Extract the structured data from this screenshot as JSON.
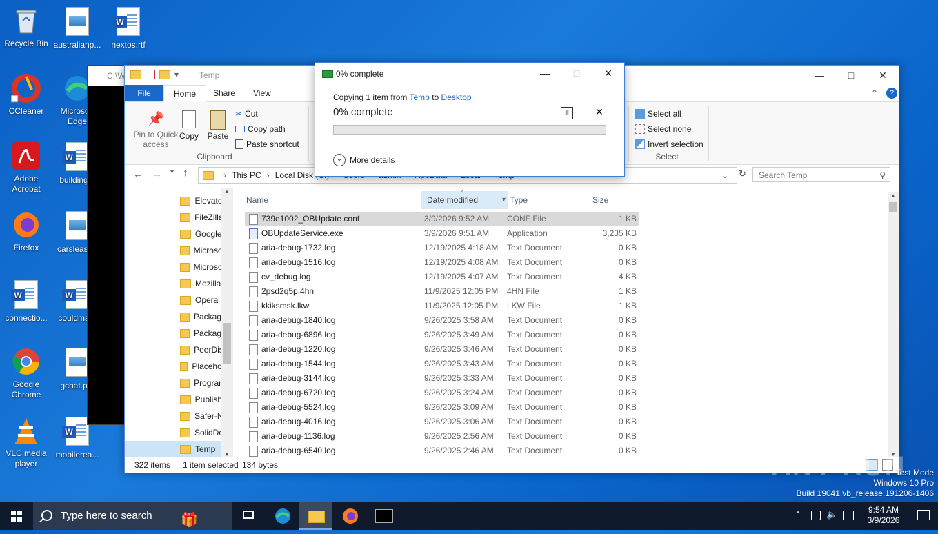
{
  "desktop": {
    "icons": [
      {
        "label": "Recycle Bin"
      },
      {
        "label": "australianp..."
      },
      {
        "label": "nextos.rtf"
      },
      {
        "label": "CCleaner"
      },
      {
        "label": "Microsoft Edge"
      },
      {
        "label": "Adobe Acrobat"
      },
      {
        "label": "building..."
      },
      {
        "label": "Firefox"
      },
      {
        "label": "carsleast..."
      },
      {
        "label": "connectio..."
      },
      {
        "label": "couldma..."
      },
      {
        "label": "Google Chrome"
      },
      {
        "label": "gchat.p..."
      },
      {
        "label": "VLC media player"
      },
      {
        "label": "mobilerea..."
      }
    ]
  },
  "console": {
    "title": "C:\\W"
  },
  "explorer": {
    "title": "Temp",
    "tabs": {
      "file": "File",
      "home": "Home",
      "share": "Share",
      "view": "View"
    },
    "ribbon": {
      "pin": "Pin to Quick access",
      "copy": "Copy",
      "paste": "Paste",
      "cut": "Cut",
      "copy_path": "Copy path",
      "paste_shortcut": "Paste shortcut",
      "clipboard": "Clipboard",
      "select_all": "Select all",
      "select_none": "Select none",
      "invert_selection": "Invert selection",
      "select": "Select"
    },
    "address": [
      "This PC",
      "Local Disk (C:)",
      "Users",
      "admin",
      "AppData",
      "Local",
      "Temp"
    ],
    "search_placeholder": "Search Temp",
    "nav": [
      "Elevate",
      "FileZilla",
      "Google",
      "Microsoft",
      "Microsoft",
      "Mozilla",
      "Opera",
      "Package",
      "Package",
      "PeerDist",
      "Placeholder",
      "Program",
      "Publish",
      "Safer-N",
      "SolidDo",
      "Temp"
    ],
    "columns": {
      "name": "Name",
      "date": "Date modified",
      "type": "Type",
      "size": "Size"
    },
    "files": [
      {
        "name": "739e1002_OBUpdate.conf",
        "date": "3/9/2026 9:52 AM",
        "type": "CONF File",
        "size": "1 KB",
        "kind": "file"
      },
      {
        "name": "OBUpdateService.exe",
        "date": "3/9/2026 9:51 AM",
        "type": "Application",
        "size": "3,235 KB",
        "kind": "exe"
      },
      {
        "name": "aria-debug-1732.log",
        "date": "12/19/2025 4:18 AM",
        "type": "Text Document",
        "size": "0 KB",
        "kind": "file"
      },
      {
        "name": "aria-debug-1516.log",
        "date": "12/19/2025 4:08 AM",
        "type": "Text Document",
        "size": "0 KB",
        "kind": "file"
      },
      {
        "name": "cv_debug.log",
        "date": "12/19/2025 4:07 AM",
        "type": "Text Document",
        "size": "4 KB",
        "kind": "file"
      },
      {
        "name": "2psd2q5p.4hn",
        "date": "11/9/2025 12:05 PM",
        "type": "4HN File",
        "size": "1 KB",
        "kind": "file"
      },
      {
        "name": "kkiksmsk.lkw",
        "date": "11/9/2025 12:05 PM",
        "type": "LKW File",
        "size": "1 KB",
        "kind": "file"
      },
      {
        "name": "aria-debug-1840.log",
        "date": "9/26/2025 3:58 AM",
        "type": "Text Document",
        "size": "0 KB",
        "kind": "file"
      },
      {
        "name": "aria-debug-6896.log",
        "date": "9/26/2025 3:49 AM",
        "type": "Text Document",
        "size": "0 KB",
        "kind": "file"
      },
      {
        "name": "aria-debug-1220.log",
        "date": "9/26/2025 3:46 AM",
        "type": "Text Document",
        "size": "0 KB",
        "kind": "file"
      },
      {
        "name": "aria-debug-1544.log",
        "date": "9/26/2025 3:43 AM",
        "type": "Text Document",
        "size": "0 KB",
        "kind": "file"
      },
      {
        "name": "aria-debug-3144.log",
        "date": "9/26/2025 3:33 AM",
        "type": "Text Document",
        "size": "0 KB",
        "kind": "file"
      },
      {
        "name": "aria-debug-6720.log",
        "date": "9/26/2025 3:24 AM",
        "type": "Text Document",
        "size": "0 KB",
        "kind": "file"
      },
      {
        "name": "aria-debug-5524.log",
        "date": "9/26/2025 3:09 AM",
        "type": "Text Document",
        "size": "0 KB",
        "kind": "file"
      },
      {
        "name": "aria-debug-4016.log",
        "date": "9/26/2025 3:06 AM",
        "type": "Text Document",
        "size": "0 KB",
        "kind": "file"
      },
      {
        "name": "aria-debug-1136.log",
        "date": "9/26/2025 2:56 AM",
        "type": "Text Document",
        "size": "0 KB",
        "kind": "file"
      },
      {
        "name": "aria-debug-6540.log",
        "date": "9/26/2025 2:46 AM",
        "type": "Text Document",
        "size": "0 KB",
        "kind": "file"
      }
    ],
    "status": {
      "items": "322 items",
      "selected": "1 item selected",
      "size": "134 bytes"
    }
  },
  "dialog": {
    "title": "0% complete",
    "copying_prefix": "Copying 1 item from",
    "from": "Temp",
    "to_word": "to",
    "to": "Desktop",
    "percent_text": "0% complete",
    "progress": 0,
    "more_details": "More details"
  },
  "taskbar": {
    "search_placeholder": "Type here to search",
    "time": "9:54 AM",
    "date": "3/9/2026"
  },
  "watermark": {
    "line1": "Test Mode",
    "line2": "Windows 10 Pro",
    "line3": "Build 19041.vb_release.191206-1406",
    "brand": "ANY RUN"
  },
  "colors": {
    "accent": "#1a68c8",
    "progress": "#06b025",
    "taskbar": "#0f1b2d"
  }
}
